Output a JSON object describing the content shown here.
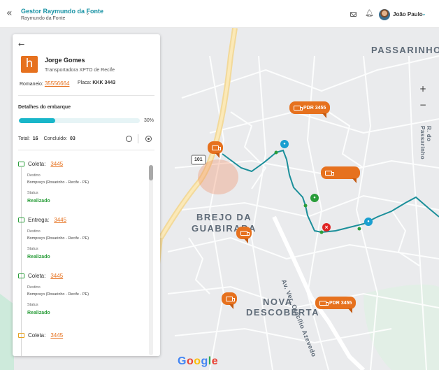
{
  "header": {
    "manager_name": "Gestor Raymundo da Fonte",
    "manager_sub": "Raymundo da Fonte",
    "user_name": "João Paulo"
  },
  "map": {
    "labels": {
      "passarinho": "PASSARINHO",
      "brejo": "BREJO DA",
      "guabiraba": "GUABIRABA",
      "nova": "NOVA",
      "descoberta": "DESCOBERTA",
      "avenue": "Av. Ver. Otacílio Azevedo",
      "road_right": "R. do Passarinho",
      "highway": "101"
    },
    "markers": [
      {
        "label": "PDR 3455"
      },
      {
        "label": "PDR 3455"
      }
    ],
    "zoom_in": "+",
    "zoom_out": "−",
    "google": [
      "G",
      "o",
      "o",
      "g",
      "l",
      "e"
    ],
    "route_color": "#1b8f9a",
    "marker_color": "#e6711e"
  },
  "panel": {
    "driver_name": "Jorge Gomes",
    "carrier": "Transportadora XPTO de Recife",
    "romaneio_label": "Romaneio:",
    "romaneio_value": "35556664",
    "placa_label": "Placa:",
    "placa_value": "KKK 3443",
    "section_title": "Detalhes do embarque",
    "progress_percent": 30,
    "progress_label": "30%",
    "total_label": "Total:",
    "total_value": "16",
    "concluido_label": "Concluído:",
    "concluido_value": "03",
    "stops": [
      {
        "type": "Coleta:",
        "code": "3445",
        "destino_label": "Destino",
        "destino": "Bompreço (Rosarinho - Recife - PE)",
        "status_label": "Status",
        "status": "Realizado"
      },
      {
        "type": "Entrega:",
        "code": "3445",
        "destino_label": "Destino",
        "destino": "Bompreço (Rosarinho - Recife - PE)",
        "status_label": "Status",
        "status": "Realizado"
      },
      {
        "type": "Coleta:",
        "code": "3445",
        "destino_label": "Destino",
        "destino": "Bompreço (Rosarinho - Recife - PE)",
        "status_label": "Status",
        "status": "Realizado"
      },
      {
        "type": "Coleta:",
        "code": "3445"
      }
    ]
  }
}
